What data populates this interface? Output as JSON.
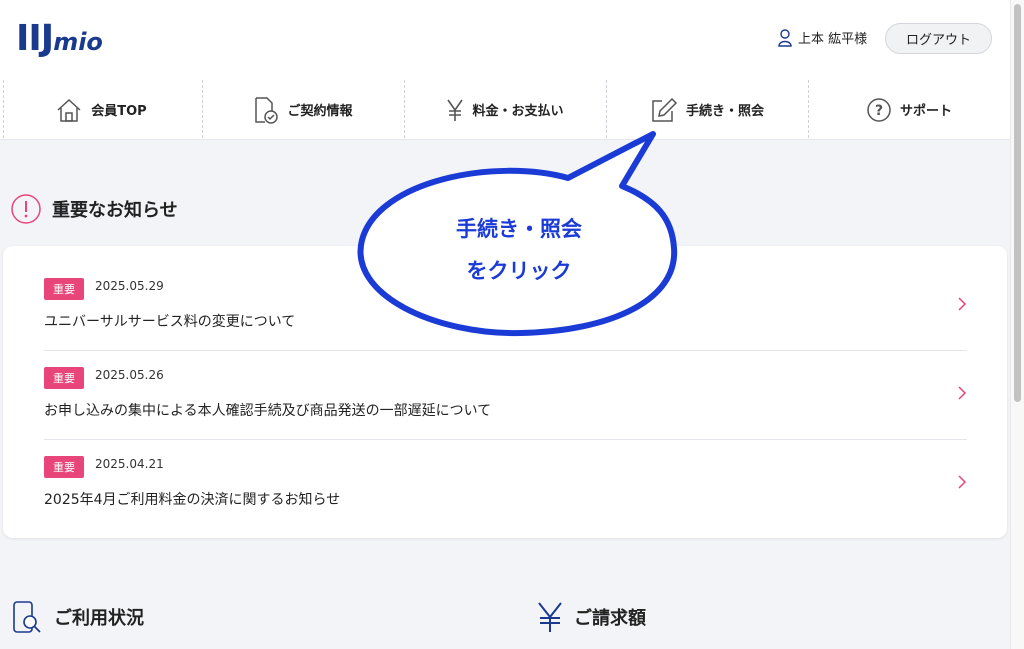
{
  "header": {
    "logo_main": "IIJ",
    "logo_sub": "mio",
    "user_name": "上本 紘平様",
    "logout_label": "ログアウト"
  },
  "nav": {
    "items": [
      {
        "label": "会員TOP",
        "icon": "home-icon"
      },
      {
        "label": "ご契約情報",
        "icon": "contract-document-icon"
      },
      {
        "label": "料金・お支払い",
        "icon": "yen-icon"
      },
      {
        "label": "手続き・照会",
        "icon": "edit-icon"
      },
      {
        "label": "サポート",
        "icon": "help-icon"
      }
    ]
  },
  "annotation": {
    "line1": "手続き・照会",
    "line2": "をクリック"
  },
  "important": {
    "title": "重要なお知らせ",
    "notices": [
      {
        "badge": "重要",
        "date": "2025.05.29",
        "title": "ユニバーサルサービス料の変更について"
      },
      {
        "badge": "重要",
        "date": "2025.05.26",
        "title": "お申し込みの集中による本人確認手続及び商品発送の一部遅延について"
      },
      {
        "badge": "重要",
        "date": "2025.04.21",
        "title": "2025年4月ご利用料金の決済に関するお知らせ"
      }
    ]
  },
  "usage": {
    "title": "ご利用状況"
  },
  "billing": {
    "title": "ご請求額"
  },
  "colors": {
    "brand": "#1a3a8f",
    "accent_pink": "#e8457a",
    "annotation_blue": "#1b3bd6"
  }
}
